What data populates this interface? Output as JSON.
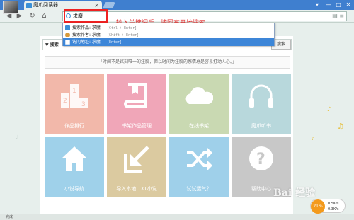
{
  "browser": {
    "tab_title": "魔爪阅读器",
    "tab_close": "×",
    "controls": [
      "▾",
      "—",
      "□",
      "✕"
    ]
  },
  "toolbar": {
    "back": "◀",
    "forward": "▶",
    "reload": "↻",
    "home": "⌂",
    "address_value": "求魔",
    "right_icons": "▤ ≡"
  },
  "annotation": "输入关键词后，按回车开始搜索",
  "dropdown": [
    {
      "label": "搜索作品: 求魔",
      "hint": " - [Ctrl + Enter]",
      "icon": "#3a8fd6"
    },
    {
      "label": "搜索作者: 求魔",
      "hint": " - [Shift + Enter]",
      "icon": "#d89a3a"
    },
    {
      "label": "访问地址: 求魔",
      "hint": " - [Enter]",
      "icon": "#ffffff"
    }
  ],
  "search": {
    "scope_label": "▼ 搜索",
    "button_label": "搜索"
  },
  "quote": "「时间不是铭刻唯一的注脚，但以时间为注脚的感情总是容易打动人心。」",
  "tiles": [
    {
      "label": "作品排行",
      "color": "#f2b8aa",
      "icon": "ranking-icon"
    },
    {
      "label": "书架作品管理",
      "color": "#f0a6b8",
      "icon": "book-icon"
    },
    {
      "label": "在线书架",
      "color": "#c9d9b2",
      "icon": "cloud-icon"
    },
    {
      "label": "魔爪听书",
      "color": "#b8d8dc",
      "icon": "headphones-icon"
    },
    {
      "label": "小说导航",
      "color": "#9fd1ea",
      "icon": "home-icon"
    },
    {
      "label": "导入本地.TXT小说",
      "color": "#dbcaa0",
      "icon": "import-arrow-icon"
    },
    {
      "label": "试试运气？",
      "color": "#9fd0ea",
      "icon": "shuffle-icon"
    },
    {
      "label": "帮助中心",
      "color": "#c8c8c8",
      "icon": "help-icon"
    }
  ],
  "watermark": "Bai 经验",
  "speed": {
    "badge": "21%",
    "up": "0.5K/s",
    "down": "0.3K/s"
  },
  "status": "完成"
}
